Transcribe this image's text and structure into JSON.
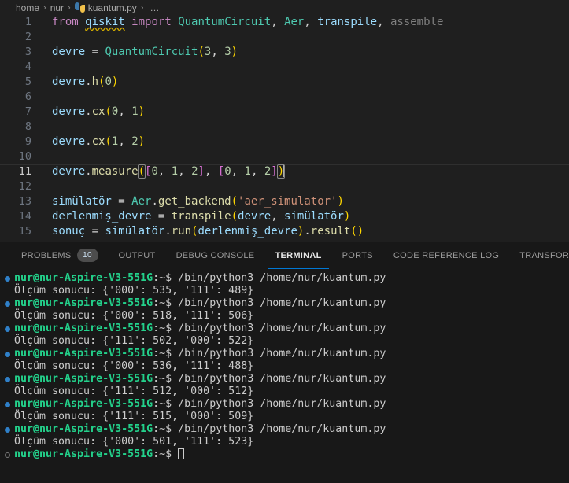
{
  "breadcrumb": {
    "items": [
      "home",
      "nur",
      "kuantum.py"
    ],
    "file_icon": "python-icon",
    "separator": "›",
    "ellipsis": "…"
  },
  "editor": {
    "language": "python",
    "file_name": "kuantum.py",
    "current_line": 11,
    "lines": [
      {
        "n": "1",
        "text": "from qiskit import QuantumCircuit, Aer, transpile, assemble"
      },
      {
        "n": "2",
        "text": ""
      },
      {
        "n": "3",
        "text": "devre = QuantumCircuit(3, 3)"
      },
      {
        "n": "4",
        "text": ""
      },
      {
        "n": "5",
        "text": "devre.h(0)"
      },
      {
        "n": "6",
        "text": ""
      },
      {
        "n": "7",
        "text": "devre.cx(0, 1)"
      },
      {
        "n": "8",
        "text": ""
      },
      {
        "n": "9",
        "text": "devre.cx(1, 2)"
      },
      {
        "n": "10",
        "text": ""
      },
      {
        "n": "11",
        "text": "devre.measure([0, 1, 2], [0, 1, 2])"
      },
      {
        "n": "12",
        "text": ""
      },
      {
        "n": "13",
        "text": "simülatör = Aer.get_backend('aer_simulator')"
      },
      {
        "n": "14",
        "text": "derlenmiş_devre = transpile(devre, simülatör)"
      },
      {
        "n": "15",
        "text": "sonuç = simülatör.run(derlenmiş_devre).result()"
      }
    ],
    "tokens": {
      "from": "from",
      "qiskit": "qiskit",
      "import": "import",
      "quantumcircuit": "QuantumCircuit",
      "comma_sp": ", ",
      "aer": "Aer",
      "transpile": "transpile",
      "assemble": "assemble",
      "devre": "devre",
      "eq": " = ",
      "paren_open": "(",
      "paren_close": ")",
      "bracket_open": "[",
      "bracket_close": "]",
      "three": "3",
      "zero": "0",
      "one": "1",
      "two": "2",
      "dot": ".",
      "h": "h",
      "cx": "cx",
      "measure": "measure",
      "simulator_var": "simülatör",
      "get_backend": "get_backend",
      "aer_simulator_str": "'aer_simulator'",
      "derlenmis_devre": "derlenmiş_devre",
      "sonuc": "sonuç",
      "run": "run",
      "result": "result",
      "empty_parens": "()"
    }
  },
  "panel": {
    "tabs": [
      {
        "label": "PROBLEMS",
        "badge": "10",
        "active": false
      },
      {
        "label": "OUTPUT",
        "badge": null,
        "active": false
      },
      {
        "label": "DEBUG CONSOLE",
        "badge": null,
        "active": false
      },
      {
        "label": "TERMINAL",
        "badge": null,
        "active": true
      },
      {
        "label": "PORTS",
        "badge": null,
        "active": false
      },
      {
        "label": "CODE REFERENCE LOG",
        "badge": null,
        "active": false
      },
      {
        "label": "TRANSFORMATION HUB",
        "badge": null,
        "active": false
      }
    ],
    "active_tab_accent": "#0078d4"
  },
  "terminal": {
    "prompt_user": "nur@nur-Aspire-V3-551G",
    "prompt_path": ":~$",
    "command": " /bin/python3 /home/nur/kuantum.py",
    "entries": [
      {
        "type": "prompt",
        "deco": "filled"
      },
      {
        "type": "output",
        "text": "Ölçüm sonucu: {'000': 535, '111': 489}"
      },
      {
        "type": "prompt",
        "deco": "filled"
      },
      {
        "type": "output",
        "text": "Ölçüm sonucu: {'000': 518, '111': 506}"
      },
      {
        "type": "prompt",
        "deco": "filled"
      },
      {
        "type": "output",
        "text": "Ölçüm sonucu: {'111': 502, '000': 522}"
      },
      {
        "type": "prompt",
        "deco": "filled"
      },
      {
        "type": "output",
        "text": "Ölçüm sonucu: {'000': 536, '111': 488}"
      },
      {
        "type": "prompt",
        "deco": "filled"
      },
      {
        "type": "output",
        "text": "Ölçüm sonucu: {'111': 512, '000': 512}"
      },
      {
        "type": "prompt",
        "deco": "filled"
      },
      {
        "type": "output",
        "text": "Ölçüm sonucu: {'111': 515, '000': 509}"
      },
      {
        "type": "prompt",
        "deco": "filled"
      },
      {
        "type": "output",
        "text": "Ölçüm sonucu: {'000': 501, '111': 523}"
      },
      {
        "type": "input",
        "deco": "hollow"
      }
    ],
    "colors": {
      "prompt_green": "#23d18b",
      "text": "#cccccc",
      "deco_blue": "#2f80c9",
      "background": "#181818"
    }
  }
}
